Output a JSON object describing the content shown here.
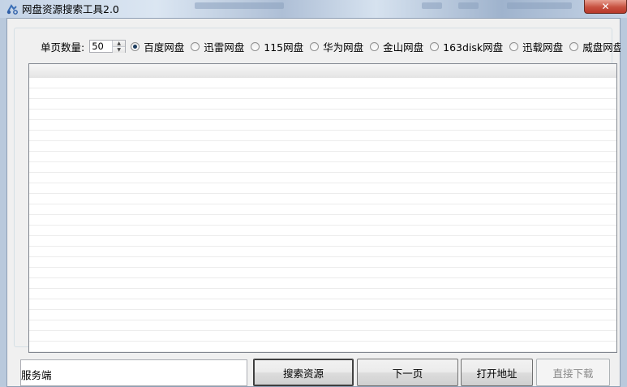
{
  "window": {
    "title": "网盘资源搜索工具2.0",
    "close_label": "✕"
  },
  "options": {
    "count_label": "单页数量:",
    "count_value": "50",
    "providers": [
      {
        "label": "百度网盘",
        "selected": true
      },
      {
        "label": "迅雷网盘",
        "selected": false
      },
      {
        "label": "115网盘",
        "selected": false
      },
      {
        "label": "华为网盘",
        "selected": false
      },
      {
        "label": "金山网盘",
        "selected": false
      },
      {
        "label": "163disk网盘",
        "selected": false
      },
      {
        "label": "迅载网盘",
        "selected": false
      },
      {
        "label": "威盘网盘",
        "selected": false
      }
    ]
  },
  "footer": {
    "server_value": "服务端",
    "search_button": "搜索资源",
    "next_button": "下一页",
    "open_button": "打开地址",
    "download_button": "直接下载"
  }
}
